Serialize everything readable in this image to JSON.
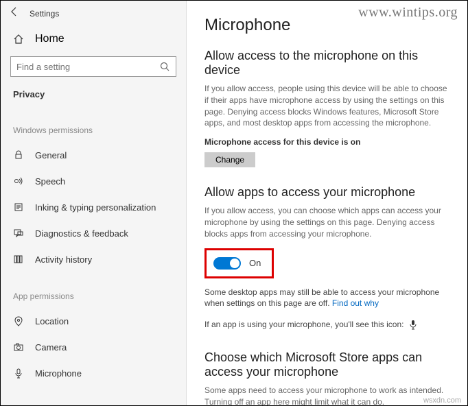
{
  "titlebar": {
    "title": "Settings"
  },
  "home": {
    "label": "Home"
  },
  "search": {
    "placeholder": "Find a setting"
  },
  "category": "Privacy",
  "sections": {
    "windows_permissions": {
      "header": "Windows permissions",
      "items": [
        {
          "label": "General"
        },
        {
          "label": "Speech"
        },
        {
          "label": "Inking & typing personalization"
        },
        {
          "label": "Diagnostics & feedback"
        },
        {
          "label": "Activity history"
        }
      ]
    },
    "app_permissions": {
      "header": "App permissions",
      "items": [
        {
          "label": "Location"
        },
        {
          "label": "Camera"
        },
        {
          "label": "Microphone"
        }
      ]
    }
  },
  "main": {
    "page_title": "Microphone",
    "section1": {
      "title": "Allow access to the microphone on this device",
      "desc": "If you allow access, people using this device will be able to choose if their apps have microphone access by using the settings on this page. Denying access blocks Windows features, Microsoft Store apps, and most desktop apps from accessing the microphone.",
      "status": "Microphone access for this device is on",
      "change_btn": "Change"
    },
    "section2": {
      "title": "Allow apps to access your microphone",
      "desc": "If you allow access, you can choose which apps can access your microphone by using the settings on this page. Denying access blocks apps from accessing your microphone.",
      "toggle_state": "On",
      "note_prefix": "Some desktop apps may still be able to access your microphone when settings on this page are off. ",
      "note_link": "Find out why",
      "indicator_text": "If an app is using your microphone, you'll see this icon:"
    },
    "section3": {
      "title": "Choose which Microsoft Store apps can access your microphone",
      "desc": "Some apps need to access your microphone to work as intended. Turning off an app here might limit what it can do."
    }
  },
  "watermark": "www.wintips.org",
  "footer": "wsxdn.com"
}
